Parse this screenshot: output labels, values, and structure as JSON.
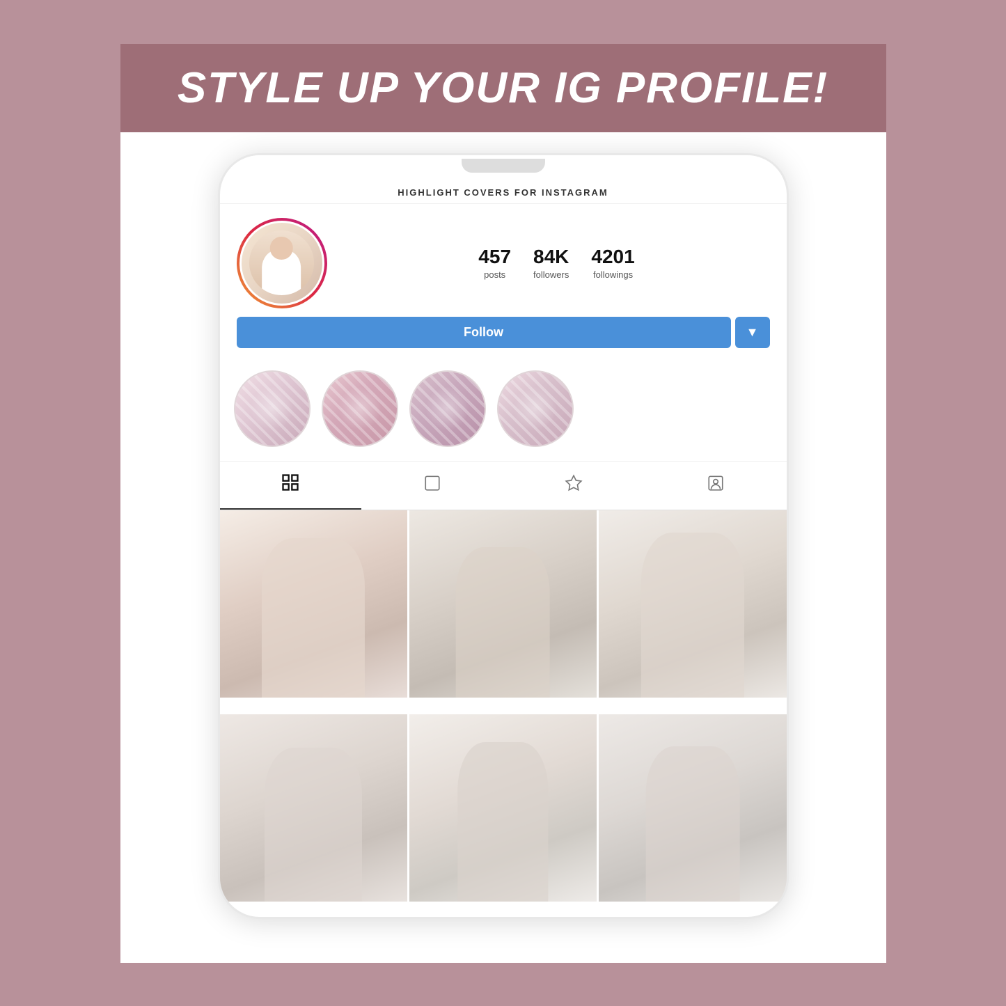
{
  "page": {
    "background_color": "#b8919a"
  },
  "title_banner": {
    "text": "STYLE UP YOUR IG PROFILE!",
    "background_color": "#9e6e77",
    "text_color": "#ffffff"
  },
  "phone": {
    "header": {
      "text": "HIGHLIGHT COVERS FOR INSTAGRAM"
    },
    "profile": {
      "posts_count": "457",
      "posts_label": "posts",
      "followers_count": "84K",
      "followers_label": "followers",
      "followings_count": "4201",
      "followings_label": "followings",
      "follow_button_label": "Follow",
      "follow_button_color": "#4A90D9"
    },
    "highlights": [
      {
        "id": 1,
        "pattern": "v1"
      },
      {
        "id": 2,
        "pattern": "v2"
      },
      {
        "id": 3,
        "pattern": "v3"
      },
      {
        "id": 4,
        "pattern": "v4"
      }
    ],
    "tabs": [
      {
        "id": "grid",
        "icon": "⊞",
        "active": true
      },
      {
        "id": "feed",
        "icon": "▣",
        "active": false
      },
      {
        "id": "saved",
        "icon": "✩",
        "active": false
      },
      {
        "id": "tagged",
        "icon": "👤",
        "active": false
      }
    ],
    "grid_photos": [
      {
        "id": 1,
        "class": "photo-1"
      },
      {
        "id": 2,
        "class": "photo-2"
      },
      {
        "id": 3,
        "class": "photo-3"
      },
      {
        "id": 4,
        "class": "photo-4"
      },
      {
        "id": 5,
        "class": "photo-5"
      },
      {
        "id": 6,
        "class": "photo-6"
      }
    ]
  }
}
